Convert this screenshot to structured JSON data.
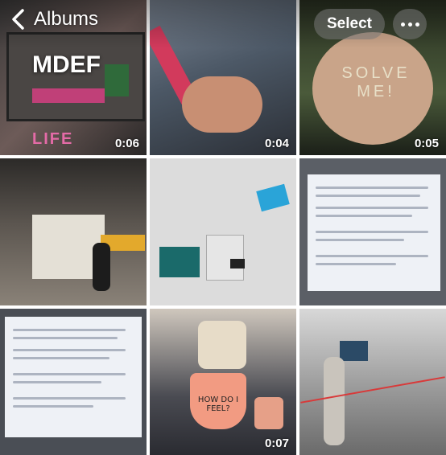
{
  "header": {
    "back_label": "Albums",
    "album_title": "MDEF",
    "select_label": "Select"
  },
  "tiles": [
    {
      "duration": "0:06",
      "overlay_text": "LIFE"
    },
    {
      "duration": "0:04"
    },
    {
      "duration": "0:05",
      "overlay_text": "SOLVE ME!"
    },
    {
      "duration": ""
    },
    {
      "duration": ""
    },
    {
      "duration": ""
    },
    {
      "duration": ""
    },
    {
      "duration": "0:07",
      "overlay_text": "HOW DO I FEEL?"
    },
    {
      "duration": ""
    }
  ],
  "colors": {
    "overlay_text": "#ffffff",
    "pill_bg": "#787878"
  }
}
